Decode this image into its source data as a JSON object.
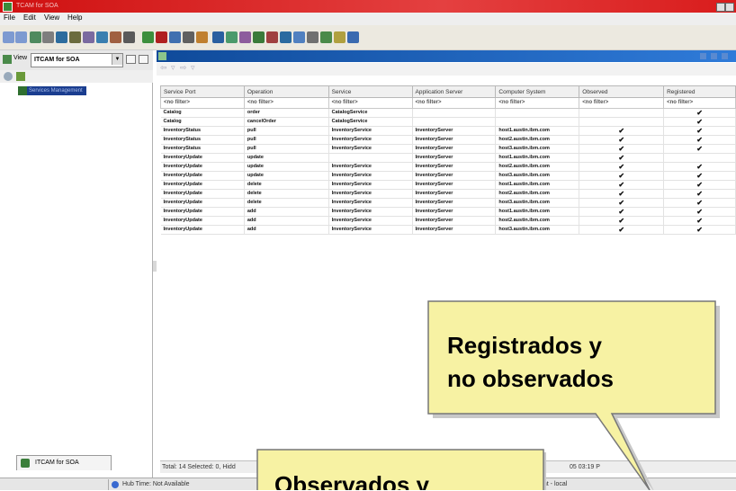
{
  "window": {
    "title": "TCAM for SOA"
  },
  "menu": [
    "File",
    "Edit",
    "View",
    "Help"
  ],
  "toolbar": {
    "icons": [
      {
        "name": "back-icon",
        "color": "#7d9ad1"
      },
      {
        "name": "forward-icon",
        "color": "#7d9ad1"
      },
      {
        "name": "workspace-icon",
        "color": "#4f8a5e"
      },
      {
        "name": "table-icon",
        "color": "#7e7e7e"
      },
      {
        "name": "grid-icon",
        "color": "#2d6c9e"
      },
      {
        "name": "chart-icon",
        "color": "#6b6b3d"
      },
      {
        "name": "report-icon",
        "color": "#7a6aa0"
      },
      {
        "name": "map-icon",
        "color": "#3a7fb0"
      },
      {
        "name": "graph-icon",
        "color": "#a06040"
      },
      {
        "name": "properties-icon",
        "color": "#5a5a5a"
      },
      {
        "name": "refresh-icon",
        "color": "#3d8f3d"
      },
      {
        "name": "stop-icon",
        "color": "#b02020"
      },
      {
        "name": "settings-icon",
        "color": "#4070b0"
      },
      {
        "name": "print-icon",
        "color": "#606060"
      },
      {
        "name": "export-icon",
        "color": "#c08030"
      },
      {
        "name": "view-table-icon",
        "color": "#2a5fa0"
      },
      {
        "name": "topology-icon",
        "color": "#4b9a6b"
      },
      {
        "name": "filter-icon",
        "color": "#8d5c9d"
      },
      {
        "name": "chart-bar-icon",
        "color": "#3a7a3a"
      },
      {
        "name": "chart-line-icon",
        "color": "#a04040"
      },
      {
        "name": "host-icon",
        "color": "#2a6aa0"
      },
      {
        "name": "server-icon",
        "color": "#5080c0"
      },
      {
        "name": "database-icon",
        "color": "#707070"
      },
      {
        "name": "tree-icon",
        "color": "#4a8a4a"
      },
      {
        "name": "notes-icon",
        "color": "#b0a040"
      },
      {
        "name": "help-icon",
        "color": "#3a6ab0"
      }
    ]
  },
  "left_panel": {
    "view_label": "View",
    "view_select": "ITCAM for SOA",
    "tree_item": "Services Management",
    "bottom_tab": "ITCAM for SOA"
  },
  "table": {
    "headers": [
      "Service Port",
      "Operation",
      "Service",
      "Application Server",
      "Computer System",
      "Observed",
      "Registered"
    ],
    "filter_text": "<no filter>",
    "rows": [
      [
        "Catalog",
        "order",
        "CatalogService",
        "",
        "",
        "",
        "✔"
      ],
      [
        "Catalog",
        "cancelOrder",
        "CatalogService",
        "",
        "",
        "",
        "✔"
      ],
      [
        "InventoryStatus",
        "pull",
        "InventoryService",
        "InventoryServer",
        "host1.austin.ibm.com",
        "✔",
        "✔"
      ],
      [
        "InventoryStatus",
        "pull",
        "InventoryService",
        "InventoryServer",
        "host2.austin.ibm.com",
        "✔",
        "✔"
      ],
      [
        "InventoryStatus",
        "pull",
        "InventoryService",
        "InventoryServer",
        "host3.austin.ibm.com",
        "✔",
        "✔"
      ],
      [
        "InventoryUpdate",
        "update",
        "",
        "InventoryServer",
        "host1.austin.ibm.com",
        "✔",
        ""
      ],
      [
        "InventoryUpdate",
        "update",
        "InventoryService",
        "InventoryServer",
        "host2.austin.ibm.com",
        "✔",
        "✔"
      ],
      [
        "InventoryUpdate",
        "update",
        "InventoryService",
        "InventoryServer",
        "host3.austin.ibm.com",
        "✔",
        "✔"
      ],
      [
        "InventoryUpdate",
        "delete",
        "InventoryService",
        "InventoryServer",
        "host1.austin.ibm.com",
        "✔",
        "✔"
      ],
      [
        "InventoryUpdate",
        "delete",
        "InventoryService",
        "InventoryServer",
        "host2.austin.ibm.com",
        "✔",
        "✔"
      ],
      [
        "InventoryUpdate",
        "delete",
        "InventoryService",
        "InventoryServer",
        "host3.austin.ibm.com",
        "✔",
        "✔"
      ],
      [
        "InventoryUpdate",
        "add",
        "InventoryService",
        "InventoryServer",
        "host1.austin.ibm.com",
        "✔",
        "✔"
      ],
      [
        "InventoryUpdate",
        "add",
        "InventoryService",
        "InventoryServer",
        "host2.austin.ibm.com",
        "✔",
        "✔"
      ],
      [
        "InventoryUpdate",
        "add",
        "InventoryService",
        "InventoryServer",
        "host3.austin.ibm.com",
        "✔",
        "✔"
      ]
    ]
  },
  "status": {
    "summary": "Total: 14 Selected: 0, Hidd",
    "summary_right": "05 03:19 P",
    "hub_time": "Hub Time: Not Available",
    "right_text": "ent - local"
  },
  "callouts": {
    "registered": {
      "line1": "Registrados y",
      "line2": "no observados",
      "fill": "#f7f2a3",
      "border": "#777777"
    },
    "observed": {
      "line1": "Observados y"
    }
  }
}
